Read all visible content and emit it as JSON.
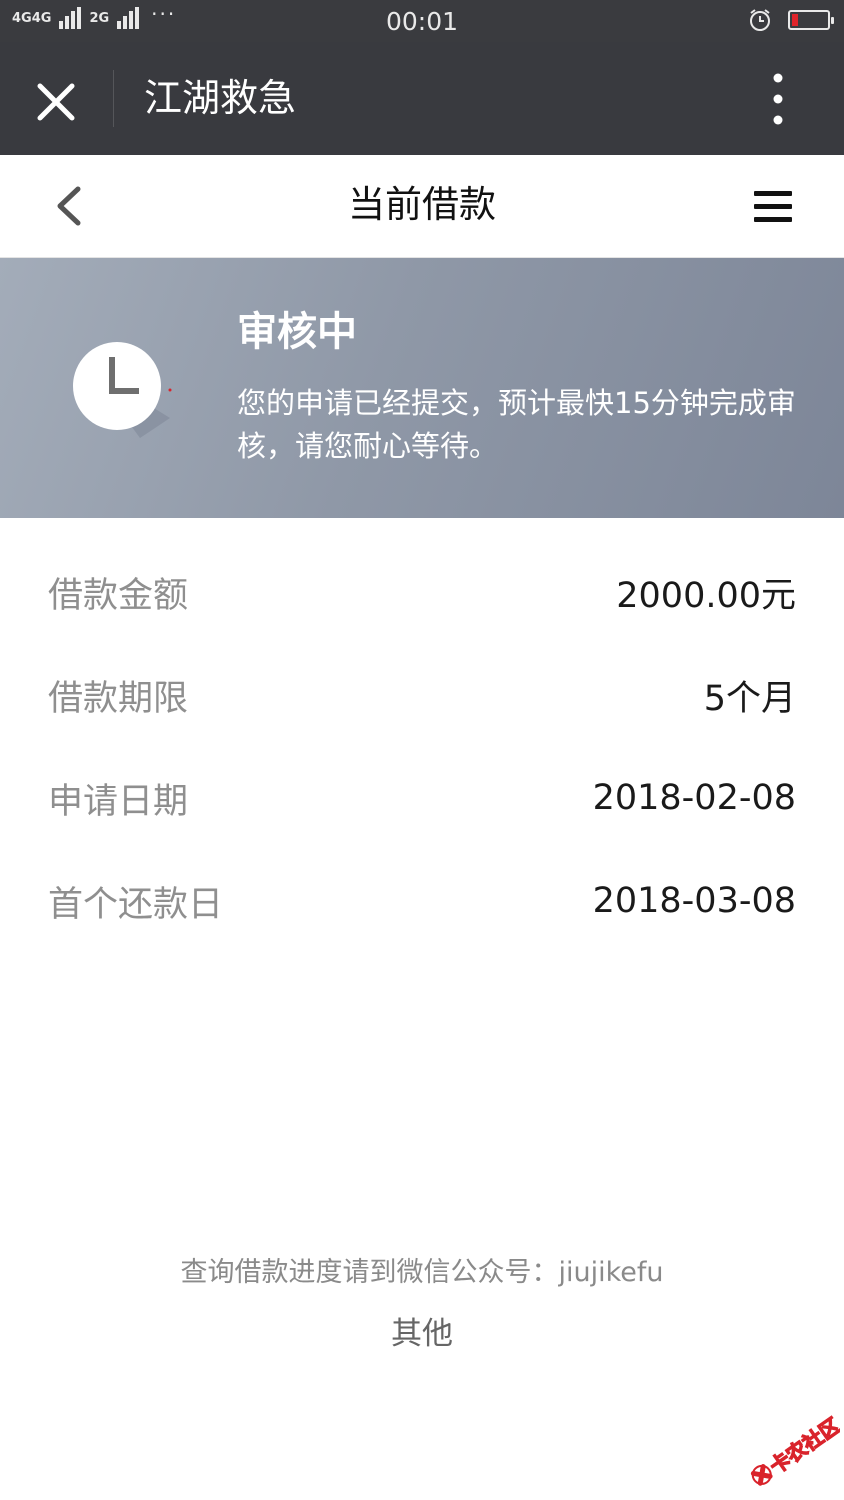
{
  "statusbar": {
    "network1": "4G",
    "network2": "4G",
    "network3": "2G",
    "more": "···",
    "time": "00:01",
    "alarm_icon": "alarm-clock-icon",
    "battery_icon": "battery-low-icon",
    "battery_color": "#e0242b"
  },
  "titlebar": {
    "close_icon": "close-icon",
    "title": "江湖救急",
    "more_icon": "more-vertical-icon"
  },
  "navbar": {
    "back_icon": "chevron-left-icon",
    "title": "当前借款",
    "menu_icon": "hamburger-menu-icon"
  },
  "status": {
    "icon": "clock-icon",
    "title": "审核中",
    "description": "您的申请已经提交，预计最快15分钟完成审核，请您耐心等待。"
  },
  "details": [
    {
      "label": "借款金额",
      "value": "2000.00元"
    },
    {
      "label": "借款期限",
      "value": "5个月"
    },
    {
      "label": "申请日期",
      "value": "2018-02-08"
    },
    {
      "label": "首个还款日",
      "value": "2018-03-08"
    }
  ],
  "footer": {
    "note": "查询借款进度请到微信公众号：jiujikefu",
    "link": "其他"
  },
  "watermark": {
    "text": "卡农社区",
    "color": "#d9232b"
  }
}
